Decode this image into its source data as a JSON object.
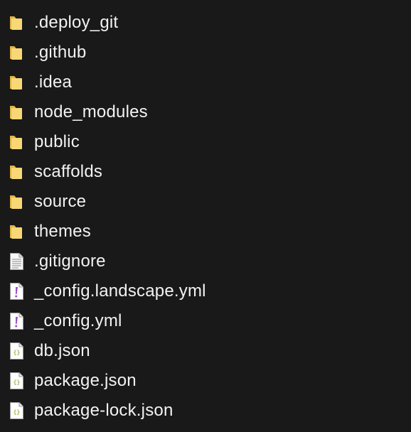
{
  "explorer": {
    "items": [
      {
        "name": ".deploy_git",
        "type": "folder",
        "icon": "folder-icon"
      },
      {
        "name": ".github",
        "type": "folder",
        "icon": "folder-icon"
      },
      {
        "name": ".idea",
        "type": "folder",
        "icon": "folder-icon"
      },
      {
        "name": "node_modules",
        "type": "folder",
        "icon": "folder-icon"
      },
      {
        "name": "public",
        "type": "folder",
        "icon": "folder-icon"
      },
      {
        "name": "scaffolds",
        "type": "folder",
        "icon": "folder-icon"
      },
      {
        "name": "source",
        "type": "folder",
        "icon": "folder-icon"
      },
      {
        "name": "themes",
        "type": "folder",
        "icon": "folder-icon"
      },
      {
        "name": ".gitignore",
        "type": "text",
        "icon": "text-file-icon"
      },
      {
        "name": "_config.landscape.yml",
        "type": "yaml",
        "icon": "yaml-file-icon"
      },
      {
        "name": "_config.yml",
        "type": "yaml",
        "icon": "yaml-file-icon"
      },
      {
        "name": "db.json",
        "type": "json",
        "icon": "json-file-icon"
      },
      {
        "name": "package.json",
        "type": "json",
        "icon": "json-file-icon"
      },
      {
        "name": "package-lock.json",
        "type": "json",
        "icon": "json-file-icon"
      }
    ]
  },
  "colors": {
    "background": "#191919",
    "text": "#f2f2f2",
    "folder": "#f8d775",
    "folder_dark": "#e0b548",
    "yaml_accent": "#9b4fc7",
    "json_accent": "#9ab34a"
  }
}
